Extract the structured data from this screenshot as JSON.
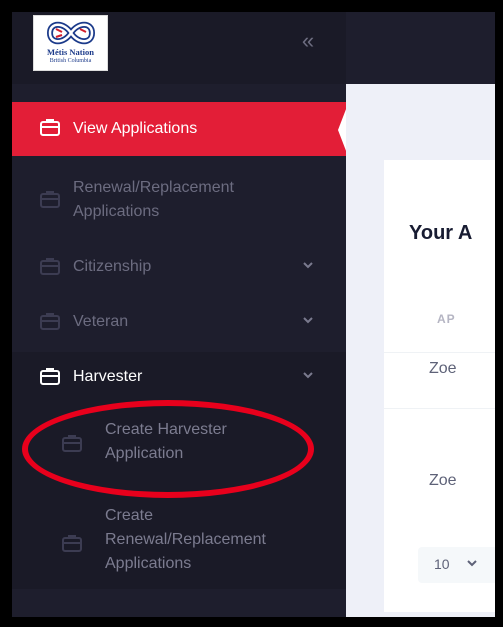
{
  "brand": {
    "logo_title": "Métis Nation",
    "logo_subtitle": "British Columbia",
    "collapse_icon": "double-chevron-left-icon"
  },
  "sidebar": {
    "items": [
      {
        "label": "View Applications",
        "icon": "briefcase-icon",
        "active": true
      },
      {
        "label": "Renewal/Replacement Applications",
        "line1": "Renewal/Replacement",
        "line2": "Applications",
        "icon": "briefcase-icon"
      },
      {
        "label": "Citizenship",
        "icon": "briefcase-icon",
        "chevron": "chevron-down-icon"
      },
      {
        "label": "Veteran",
        "icon": "briefcase-icon",
        "chevron": "chevron-down-icon"
      },
      {
        "label": "Harvester",
        "icon": "briefcase-icon",
        "chevron": "chevron-down-icon",
        "expanded": true
      }
    ],
    "harvester_sub": [
      {
        "line1": "Create Harvester",
        "line2": "Application",
        "icon": "briefcase-icon"
      },
      {
        "line1": "Create",
        "line2": "Renewal/Replacement",
        "line3": "Applications",
        "icon": "briefcase-icon"
      }
    ]
  },
  "main": {
    "card_title": "Your A",
    "column_header": "AP",
    "rows": [
      "Zoe",
      "Zoe"
    ],
    "page_size": "10"
  },
  "colors": {
    "sidebar_bg": "#1e1e2d",
    "active_bg": "#e31e37",
    "annotation": "#e8001c"
  }
}
